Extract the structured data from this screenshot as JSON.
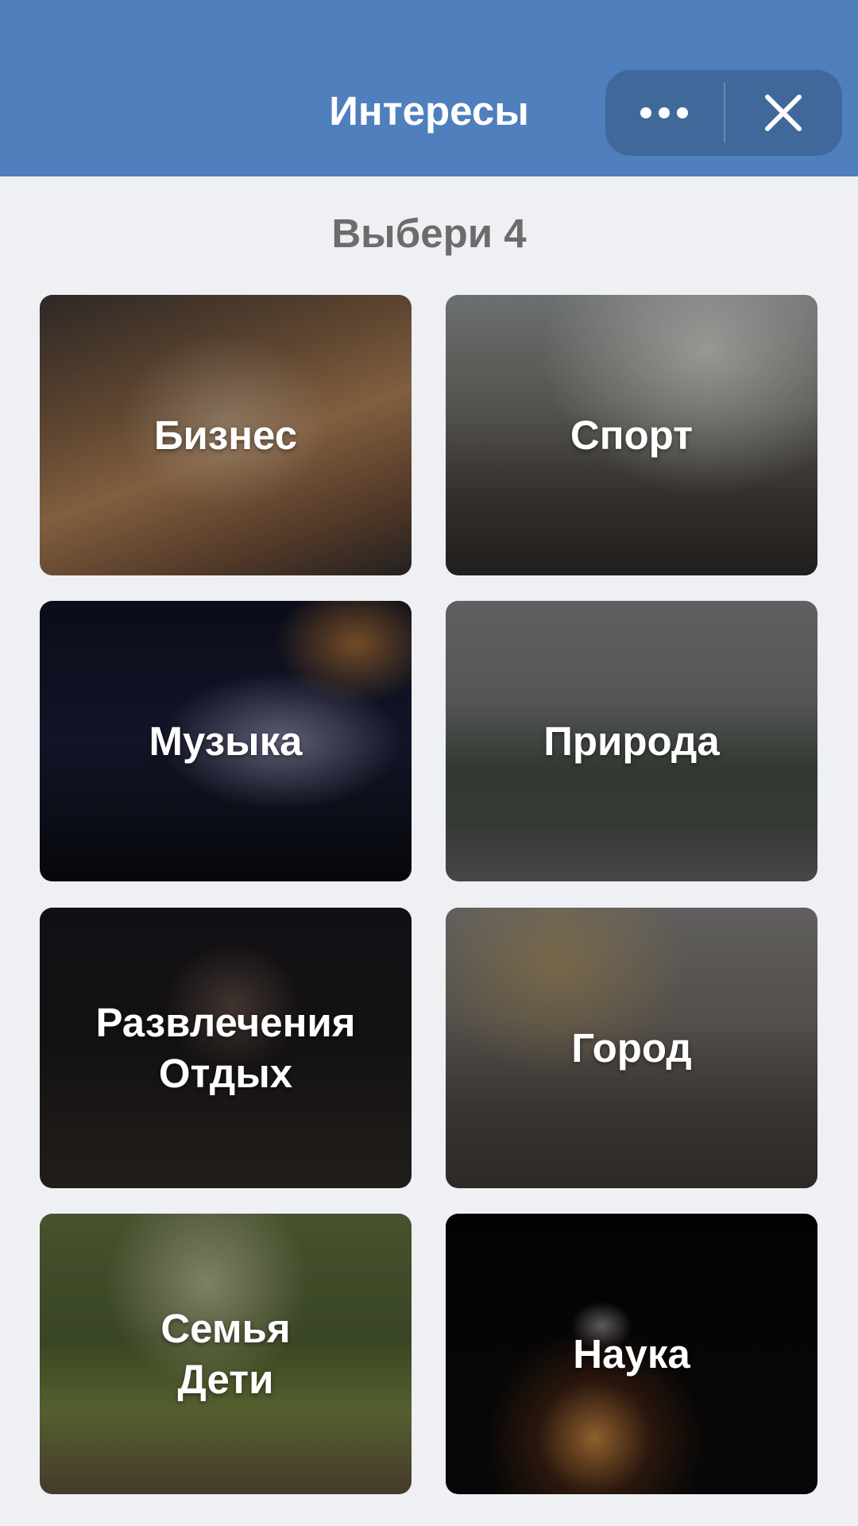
{
  "header": {
    "title": "Интересы",
    "more_icon": "more-horizontal-icon",
    "close_icon": "close-icon",
    "background": "#4f7fbd",
    "capsule_background": "#41689b"
  },
  "subtitle": "Выбери 4",
  "interests": [
    {
      "label": "Бизнес"
    },
    {
      "label": "Спорт"
    },
    {
      "label": "Музыка"
    },
    {
      "label": "Природа"
    },
    {
      "label": "Развлечения\nОтдых"
    },
    {
      "label": "Город"
    },
    {
      "label": "Семья\nДети"
    },
    {
      "label": "Наука"
    }
  ],
  "colors": {
    "page_background": "#eef0f4",
    "subtitle_text": "#6c6c6c",
    "card_text": "#ffffff"
  }
}
